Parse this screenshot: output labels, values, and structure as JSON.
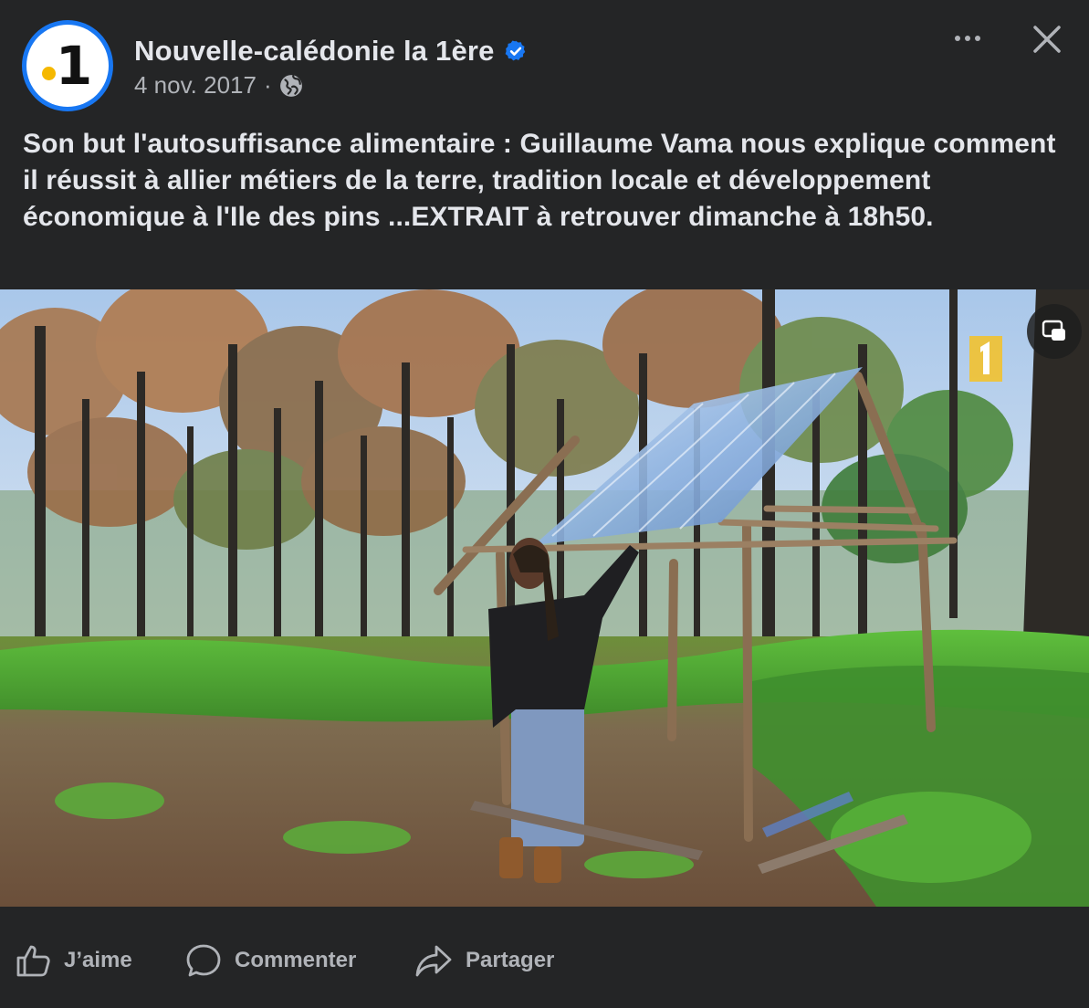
{
  "post": {
    "page_name": "Nouvelle-calédonie la 1ère",
    "avatar_label": "1",
    "date": "4 nov. 2017",
    "separator": "·",
    "text": "Son but l'autosuffisance alimentaire : Guillaume Vama nous explique comment il réussit à allier métiers de la terre, tradition locale et développement économique à l'Ile des pins ...EXTRAIT à retrouver dimanche à 18h50.",
    "watermark": "1"
  },
  "actions": {
    "like_label": "J’aime",
    "comment_label": "Commenter",
    "share_label": "Partager"
  },
  "icons": {
    "verified": "verified-badge-icon",
    "globe": "globe-icon",
    "more": "more-options-icon",
    "close": "close-icon",
    "pip": "picture-in-picture-icon",
    "like": "thumbs-up-icon",
    "comment": "comment-bubble-icon",
    "share": "share-arrow-icon"
  },
  "colors": {
    "background": "#242526",
    "text_primary": "#e4e6eb",
    "text_secondary": "#b0b3b8",
    "verified": "#1877f2",
    "avatar_dot": "#f5b800"
  }
}
